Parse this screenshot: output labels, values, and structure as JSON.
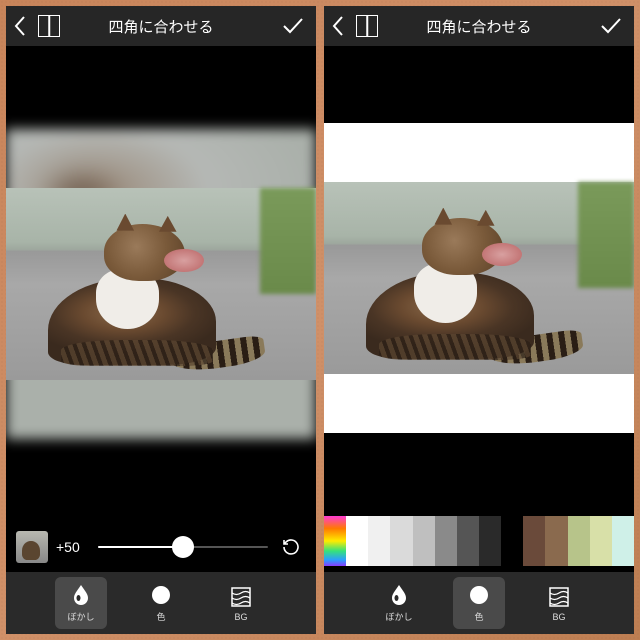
{
  "header": {
    "title": "四角に合わせる"
  },
  "left": {
    "slider": {
      "value_label": "+50",
      "value": 50,
      "min": 0,
      "max": 100
    },
    "active_tab": "blur"
  },
  "right": {
    "swatches": [
      "gradient",
      "#ffffff",
      "#f0f0f0",
      "#dadada",
      "#bfbfbf",
      "#8a8a8a",
      "#555555",
      "#2a2a2a",
      "#000000",
      "#6a4a3a",
      "#8a6a4e",
      "#b7c48a",
      "#d8e0a8",
      "#cff0e8"
    ],
    "active_tab": "color"
  },
  "tabs": {
    "blur": "ぼかし",
    "color": "色",
    "bg": "BG"
  }
}
